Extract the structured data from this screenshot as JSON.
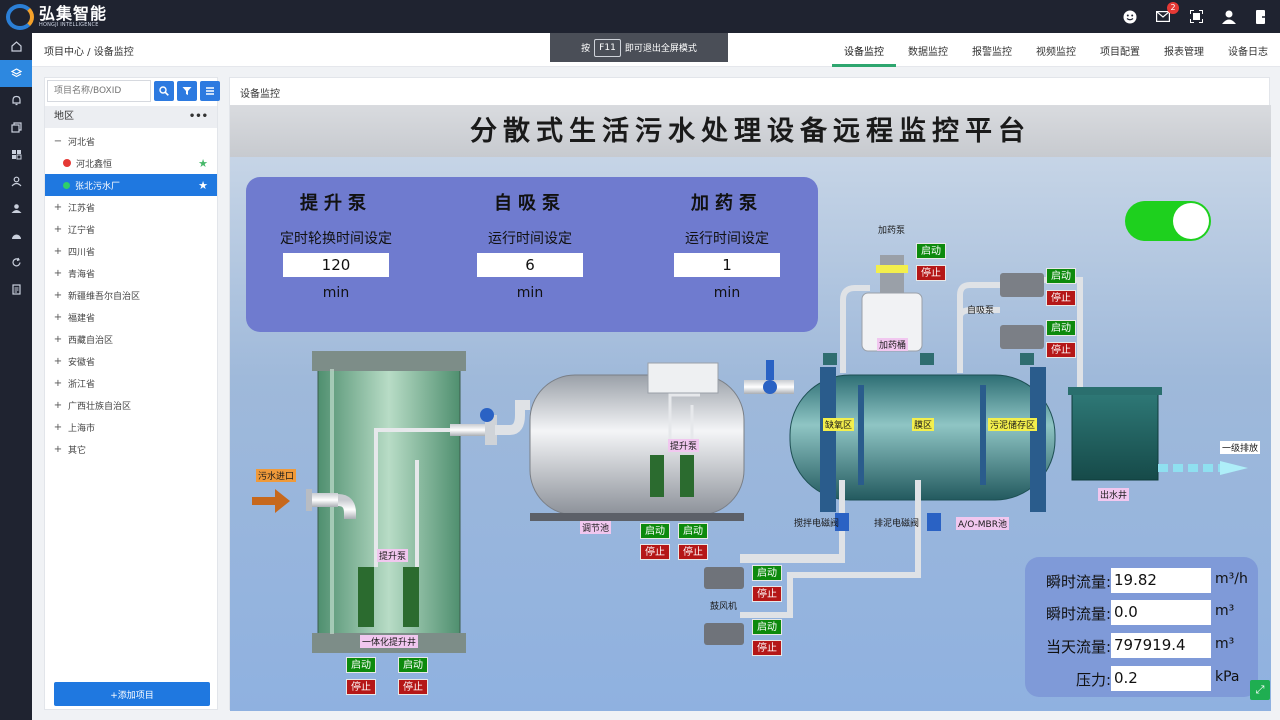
{
  "brand": {
    "name_cn": "弘集智能",
    "name_en": "HONGJI INTELLIGENCE"
  },
  "top_icons": {
    "mail_badge": "2"
  },
  "rail": [
    "home-icon",
    "layers-icon",
    "bell-icon",
    "copy-icon",
    "grid-icon",
    "user-icon",
    "group-icon",
    "dashboard-icon",
    "refresh-icon",
    "doc-icon"
  ],
  "header": {
    "breadcrumb": "项目中心 / 设备监控",
    "fullscreen_tip_prefix": "按",
    "fullscreen_tip_key": "F11",
    "fullscreen_tip_suffix": "即可退出全屏模式",
    "tabs": [
      "设备监控",
      "数据监控",
      "报警监控",
      "视频监控",
      "项目配置",
      "报表管理",
      "设备日志"
    ]
  },
  "sidebar": {
    "search_placeholder": "项目名称/BOXID",
    "region_label": "地区",
    "tree": [
      {
        "label": "河北省",
        "toggle": "−"
      },
      {
        "label": "河北鑫恒",
        "toggle": ""
      },
      {
        "label": "张北污水厂",
        "toggle": ""
      },
      {
        "label": "江苏省",
        "toggle": "+"
      },
      {
        "label": "辽宁省",
        "toggle": "+"
      },
      {
        "label": "四川省",
        "toggle": "+"
      },
      {
        "label": "青海省",
        "toggle": "+"
      },
      {
        "label": "新疆维吾尔自治区",
        "toggle": "+"
      },
      {
        "label": "福建省",
        "toggle": "+"
      },
      {
        "label": "西藏自治区",
        "toggle": "+"
      },
      {
        "label": "安徽省",
        "toggle": "+"
      },
      {
        "label": "浙江省",
        "toggle": "+"
      },
      {
        "label": "广西壮族自治区",
        "toggle": "+"
      },
      {
        "label": "上海市",
        "toggle": "+"
      },
      {
        "label": "其它",
        "toggle": "+"
      }
    ],
    "add_button": "+添加项目",
    "status_colors": {
      "alarm": "#e53935",
      "normal": "#2fcf6a"
    }
  },
  "main": {
    "title": "设备监控",
    "platform_title": "分散式生活污水处理设备远程监控平台",
    "pumps": [
      {
        "name": "提升泵",
        "label": "定时轮换时间设定",
        "value": "120",
        "unit": "min"
      },
      {
        "name": "自吸泵",
        "label": "运行时间设定",
        "value": "6",
        "unit": "min"
      },
      {
        "name": "加药泵",
        "label": "运行时间设定",
        "value": "1",
        "unit": "min"
      }
    ],
    "system_switch_on": true,
    "labels": {
      "inlet": "污水进口",
      "lift_pump_tank": "提升泵",
      "lift_well": "一体化提升井",
      "regulating_tank": "调节池",
      "regulating_pump": "提升泵",
      "dosing_pump": "加药泵",
      "dosing_tank": "加药桶",
      "self_priming_pump": "自吸泵",
      "anoxic_zone": "缺氧区",
      "membrane_zone": "膜区",
      "sludge_zone": "污泥储存区",
      "stirring_valve": "搅拌电磁阀",
      "sludge_valve": "排泥电磁阀",
      "mbr_tank": "A/O-MBR池",
      "blower": "鼓风机",
      "outlet_well": "出水井",
      "discharge": "一级排放"
    },
    "start_label": "启动",
    "stop_label": "停止",
    "flow": [
      {
        "label": "瞬时流量:",
        "value": "19.82",
        "unit": "m³/h"
      },
      {
        "label": "瞬时流量:",
        "value": "0.0",
        "unit": "m³"
      },
      {
        "label": "当天流量:",
        "value": "797919.4",
        "unit": "m³"
      },
      {
        "label": "压力:",
        "value": "0.2",
        "unit": "kPa"
      }
    ]
  }
}
